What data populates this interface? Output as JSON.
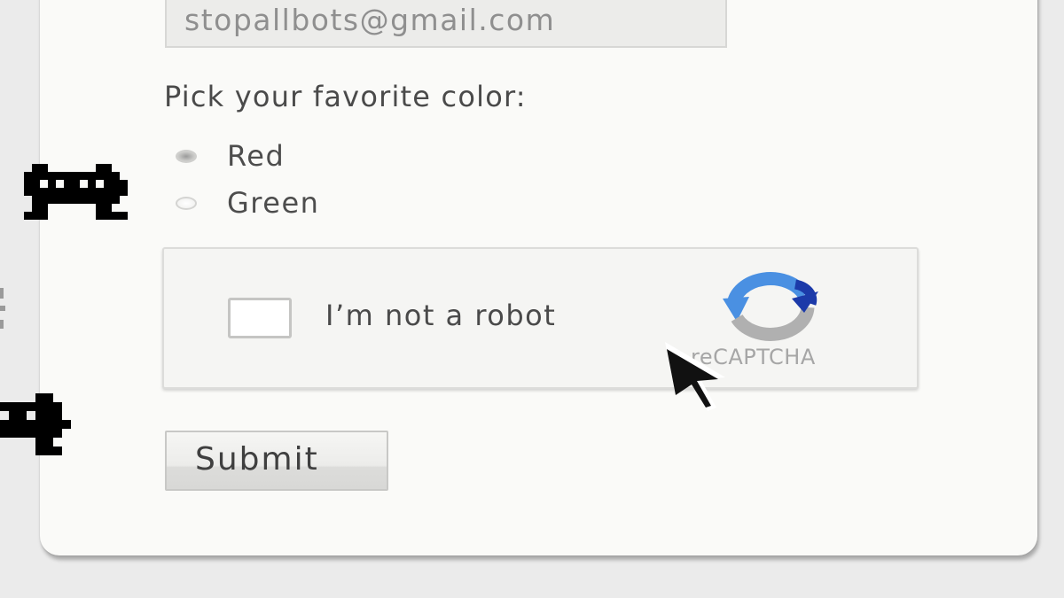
{
  "form": {
    "email_value": "stopallbots@gmail.com",
    "question": "Pick your favorite color:",
    "options": [
      {
        "label": "Red",
        "selected": true
      },
      {
        "label": "Green",
        "selected": false
      }
    ],
    "recaptcha": {
      "checkbox_label": "I’m not a robot",
      "checked": false,
      "brand_text": "reCAPTCHA",
      "logo_colors": [
        "#1c3aa9",
        "#4a90e2",
        "#b0b0b0"
      ]
    },
    "submit_label": "Submit"
  },
  "decorations": {
    "bot_sprite_color": "#000000",
    "cursor_icon": "mouse-pointer-icon"
  }
}
